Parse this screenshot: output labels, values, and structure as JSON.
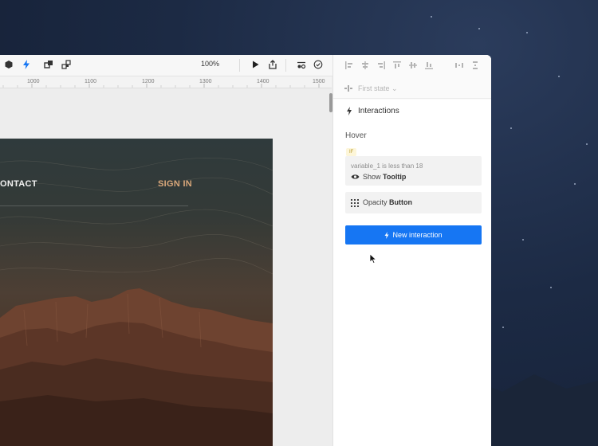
{
  "toolbar": {
    "zoom": "100%",
    "left_icons": [
      "hexagon-icon",
      "bolt-icon",
      "layers-icon",
      "components-icon"
    ],
    "right_icons": [
      "play-icon",
      "share-icon",
      "settings-icon",
      "check-circle-icon"
    ],
    "accent": "#1676f3"
  },
  "ruler": {
    "labels": [
      "1000",
      "1100",
      "1200",
      "1300",
      "1400",
      "1500"
    ]
  },
  "canvas": {
    "nav_contact": "ONTACT",
    "nav_sign_in": "SIGN IN",
    "signin_color": "#d9a77a"
  },
  "panel": {
    "state_label": "First state ⌄",
    "interactions_title": "Interactions",
    "hover_label": "Hover",
    "if_badge": "IF",
    "condition_text": "variable_1 is less than 18",
    "condition_action_verb": "Show",
    "condition_action_target": "Tooltip",
    "opacity_verb": "Opacity",
    "opacity_target": "Button",
    "new_interaction_label": "New interaction",
    "button_color": "#1676f3"
  }
}
